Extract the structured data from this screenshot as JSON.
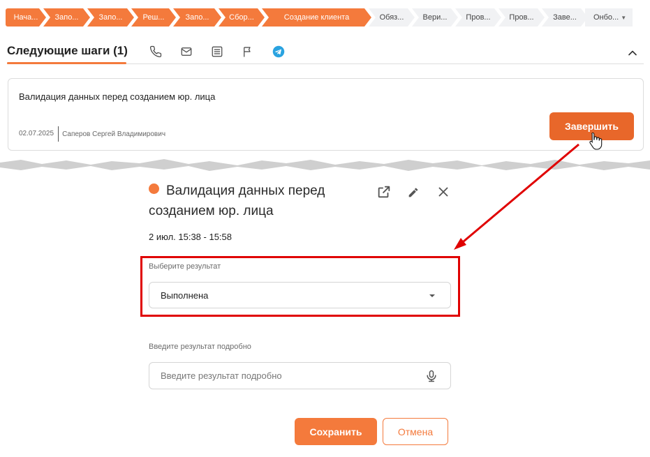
{
  "pipeline": {
    "stages": [
      {
        "label": "Нача...",
        "state": "done"
      },
      {
        "label": "Запо...",
        "state": "done"
      },
      {
        "label": "Запо...",
        "state": "done"
      },
      {
        "label": "Реш...",
        "state": "done"
      },
      {
        "label": "Запо...",
        "state": "done"
      },
      {
        "label": "Сбор...",
        "state": "done"
      },
      {
        "label": "Создание клиента",
        "state": "current"
      },
      {
        "label": "Обяз...",
        "state": "todo"
      },
      {
        "label": "Вери...",
        "state": "todo"
      },
      {
        "label": "Пров...",
        "state": "todo"
      },
      {
        "label": "Пров...",
        "state": "todo"
      },
      {
        "label": "Заве...",
        "state": "todo"
      },
      {
        "label": "Онбо...",
        "state": "todo"
      }
    ]
  },
  "header": {
    "title": "Следующие шаги (1)",
    "icons": [
      "phone-icon",
      "mail-icon",
      "list-icon",
      "flag-icon",
      "telegram-icon",
      "chevron-up-icon"
    ]
  },
  "card": {
    "task_title": "Валидация данных перед созданием юр. лица",
    "date": "02.07.2025",
    "user": "Саперов Сергей Владимирович",
    "complete_label": "Завершить"
  },
  "modal": {
    "title": "Валидация данных перед созданием юр. лица",
    "time": "2 июл. 15:38 - 15:58",
    "result_label": "Выберите результат",
    "result_value": "Выполнена",
    "details_label": "Введите результат подробно",
    "details_placeholder": "Введите результат подробно",
    "save_label": "Сохранить",
    "cancel_label": "Отмена",
    "icons": [
      "external-link-icon",
      "edit-icon",
      "close-icon",
      "microphone-icon"
    ]
  },
  "colors": {
    "accent": "#f47a3c",
    "accent_dark": "#e8672a",
    "highlight": "#e00000",
    "stage_todo": "#f1f2f4"
  }
}
